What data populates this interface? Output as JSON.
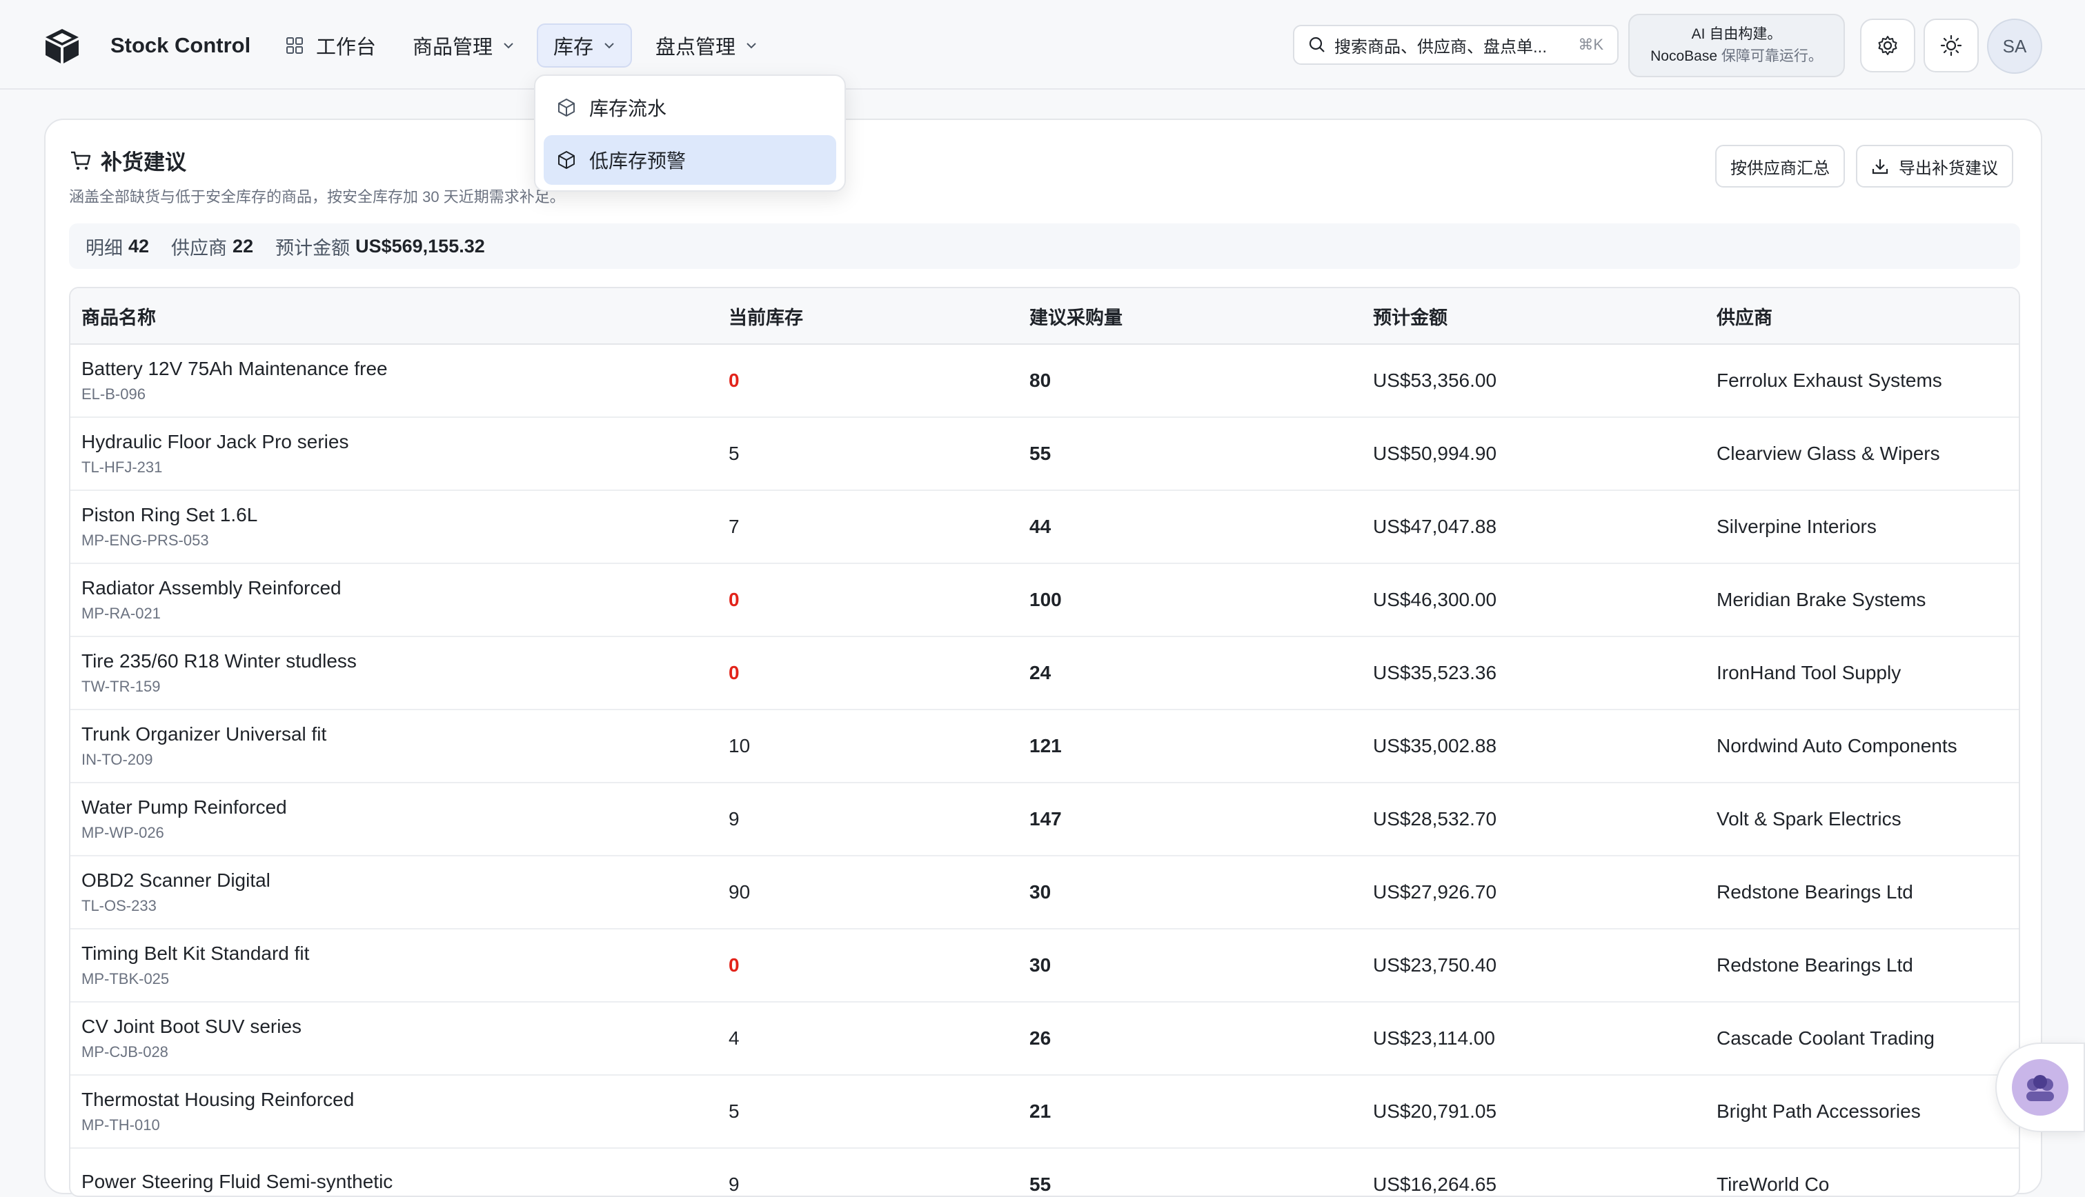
{
  "app": {
    "title": "Stock Control"
  },
  "nav": {
    "workbench": "工作台",
    "products": "商品管理",
    "inventory": "库存",
    "stocktake": "盘点管理"
  },
  "search": {
    "placeholder": "搜索商品、供应商、盘点单...",
    "shortcut": "⌘K"
  },
  "promo": {
    "line1": "AI 自由构建。",
    "line2_brand": "NocoBase",
    "line2_rest": " 保障可靠运行。"
  },
  "user": {
    "initials": "SA"
  },
  "dropdown": {
    "items": [
      {
        "label": "库存流水",
        "active": false
      },
      {
        "label": "低库存预警",
        "active": true
      }
    ]
  },
  "card": {
    "title": "补货建议",
    "description": "涵盖全部缺货与低于安全库存的商品，按安全库存加 30 天近期需求补足。",
    "buttons": {
      "by_supplier": "按供应商汇总",
      "export": "导出补货建议"
    }
  },
  "summary": {
    "items_label": "明细",
    "items_value": "42",
    "suppliers_label": "供应商",
    "suppliers_value": "22",
    "amount_label": "预计金额",
    "amount_value": "US$569,155.32"
  },
  "table": {
    "columns": [
      "商品名称",
      "当前库存",
      "建议采购量",
      "预计金额",
      "供应商"
    ],
    "rows": [
      {
        "name": "Battery 12V 75Ah Maintenance free",
        "sku": "EL-B-096",
        "stock": "0",
        "qty": "80",
        "amount": "US$53,356.00",
        "supplier": "Ferrolux Exhaust Systems"
      },
      {
        "name": "Hydraulic Floor Jack Pro series",
        "sku": "TL-HFJ-231",
        "stock": "5",
        "qty": "55",
        "amount": "US$50,994.90",
        "supplier": "Clearview Glass & Wipers"
      },
      {
        "name": "Piston Ring Set 1.6L",
        "sku": "MP-ENG-PRS-053",
        "stock": "7",
        "qty": "44",
        "amount": "US$47,047.88",
        "supplier": "Silverpine Interiors"
      },
      {
        "name": "Radiator Assembly Reinforced",
        "sku": "MP-RA-021",
        "stock": "0",
        "qty": "100",
        "amount": "US$46,300.00",
        "supplier": "Meridian Brake Systems"
      },
      {
        "name": "Tire 235/60 R18 Winter studless",
        "sku": "TW-TR-159",
        "stock": "0",
        "qty": "24",
        "amount": "US$35,523.36",
        "supplier": "IronHand Tool Supply"
      },
      {
        "name": "Trunk Organizer Universal fit",
        "sku": "IN-TO-209",
        "stock": "10",
        "qty": "121",
        "amount": "US$35,002.88",
        "supplier": "Nordwind Auto Components"
      },
      {
        "name": "Water Pump Reinforced",
        "sku": "MP-WP-026",
        "stock": "9",
        "qty": "147",
        "amount": "US$28,532.70",
        "supplier": "Volt & Spark Electrics"
      },
      {
        "name": "OBD2 Scanner Digital",
        "sku": "TL-OS-233",
        "stock": "90",
        "qty": "30",
        "amount": "US$27,926.70",
        "supplier": "Redstone Bearings Ltd"
      },
      {
        "name": "Timing Belt Kit Standard fit",
        "sku": "MP-TBK-025",
        "stock": "0",
        "qty": "30",
        "amount": "US$23,750.40",
        "supplier": "Redstone Bearings Ltd"
      },
      {
        "name": "CV Joint Boot SUV series",
        "sku": "MP-CJB-028",
        "stock": "4",
        "qty": "26",
        "amount": "US$23,114.00",
        "supplier": "Cascade Coolant Trading"
      },
      {
        "name": "Thermostat Housing Reinforced",
        "sku": "MP-TH-010",
        "stock": "5",
        "qty": "21",
        "amount": "US$20,791.05",
        "supplier": "Bright Path Accessories"
      },
      {
        "name": "Power Steering Fluid Semi-synthetic",
        "sku": "",
        "stock": "9",
        "qty": "55",
        "amount": "US$16,264.65",
        "supplier": "TireWorld Co"
      }
    ]
  },
  "colors": {
    "accent": "#dde8fb",
    "danger": "#e2231a",
    "border": "#e4e6ea"
  }
}
